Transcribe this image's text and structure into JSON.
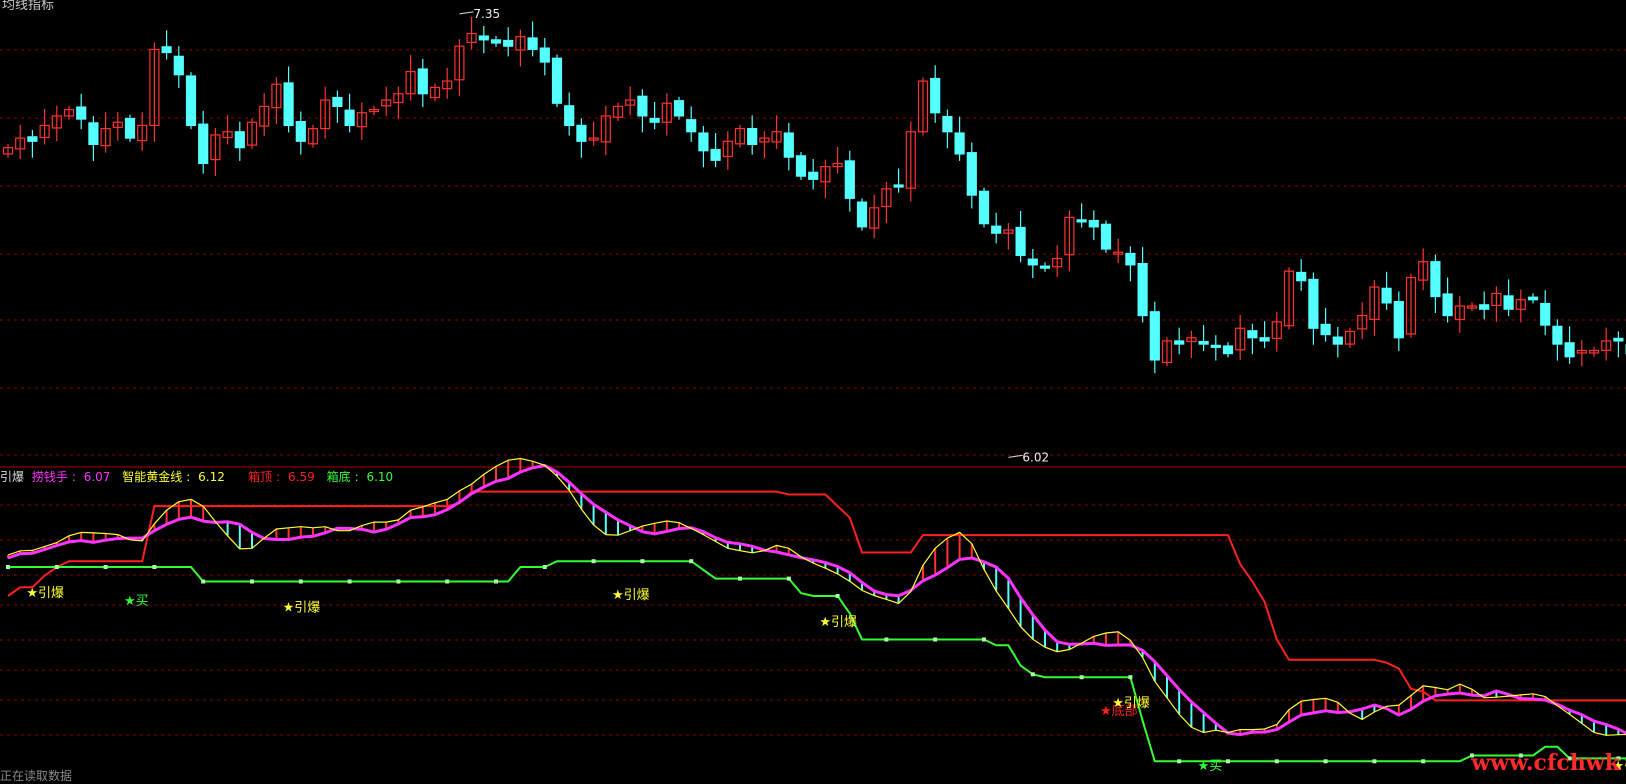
{
  "top_left_text": "均线指标",
  "main_annotations": {
    "high": "7.35",
    "low": "6.02"
  },
  "indicator_legend": {
    "name": "引爆",
    "items": [
      {
        "label": "捞钱手",
        "value": "6.07",
        "color": "#ff33ff"
      },
      {
        "label": "智能黄金线",
        "value": "6.12",
        "color": "#ffff33"
      },
      {
        "label": "箱顶",
        "value": "6.59",
        "color": "#ff2020"
      },
      {
        "label": "箱底",
        "value": "6.10",
        "color": "#33ff33"
      }
    ]
  },
  "watermark": "www.cfchwk",
  "bottom_left_text": "正在读取数据",
  "colors": {
    "up": "#ff3232",
    "down": "#54ffff",
    "grid": "#8b0000",
    "box_top": "#ff2020",
    "box_bottom": "#33ff33",
    "magenta": "#ff33ff",
    "yellow": "#ffff33"
  },
  "chart_data": [
    {
      "type": "candlestick",
      "ylim": [
        5.98,
        7.4
      ],
      "high_label": 7.35,
      "low_label": 6.02,
      "closes": [
        6.95,
        6.98,
        6.97,
        7.02,
        7.05,
        7.07,
        7.04,
        6.96,
        7.01,
        7.03,
        6.98,
        7.02,
        7.26,
        7.25,
        7.18,
        7.02,
        6.9,
        6.99,
        7.0,
        6.95,
        7.03,
        7.08,
        7.15,
        7.02,
        6.97,
        7.01,
        7.1,
        7.08,
        7.02,
        7.06,
        7.07,
        7.1,
        7.12,
        7.19,
        7.12,
        7.14,
        7.16,
        7.27,
        7.31,
        7.29,
        7.28,
        7.27,
        7.3,
        7.26,
        7.22,
        7.09,
        7.02,
        6.97,
        6.98,
        7.05,
        7.08,
        7.1,
        7.05,
        7.03,
        7.09,
        7.05,
        7.0,
        6.94,
        6.91,
        6.97,
        7.01,
        6.96,
        6.98,
        7.0,
        6.92,
        6.86,
        6.85,
        6.89,
        6.9,
        6.79,
        6.7,
        6.76,
        6.82,
        6.83,
        7.0,
        7.16,
        7.06,
        7.0,
        6.93,
        6.8,
        6.71,
        6.68,
        6.69,
        6.61,
        6.58,
        6.57,
        6.6,
        6.73,
        6.72,
        6.7,
        6.63,
        6.62,
        6.58,
        6.42,
        6.28,
        6.34,
        6.33,
        6.35,
        6.33,
        6.32,
        6.3,
        6.38,
        6.35,
        6.34,
        6.4,
        6.56,
        6.53,
        6.38,
        6.36,
        6.33,
        6.37,
        6.42,
        6.51,
        6.46,
        6.35,
        6.54,
        6.59,
        6.48,
        6.42,
        6.45,
        6.45,
        6.44,
        6.49,
        6.44,
        6.47,
        6.47,
        6.39,
        6.33,
        6.29,
        6.31,
        6.31,
        6.34,
        6.34,
        6.3,
        6.3,
        6.29,
        6.28
      ],
      "y_annotations": [
        {
          "x_index": 37,
          "value": 7.35
        },
        {
          "x_index": 82,
          "value": 6.02
        }
      ]
    },
    {
      "type": "line",
      "series": [
        {
          "name": "捞钱手",
          "color": "#ff33ff"
        },
        {
          "name": "智能黄金线",
          "color": "#ffff33"
        },
        {
          "name": "箱顶",
          "color": "#ff2020"
        },
        {
          "name": "箱底",
          "color": "#33ff33"
        }
      ],
      "last_values": {
        "捞钱手": 6.07,
        "智能黄金线": 6.12,
        "箱顶": 6.59,
        "箱底": 6.1
      },
      "signals": [
        {
          "text": "★引爆",
          "color": "#ffff33",
          "x_index": 2
        },
        {
          "text": "★买",
          "color": "#33ff33",
          "x_index": 10
        },
        {
          "text": "★引爆",
          "color": "#ffff33",
          "x_index": 23
        },
        {
          "text": "★引爆",
          "color": "#ffff33",
          "x_index": 50
        },
        {
          "text": "★引爆",
          "color": "#ffff33",
          "x_index": 67
        },
        {
          "text": "★底部",
          "color": "#ff2020",
          "x_index": 90
        },
        {
          "text": "★引爆",
          "color": "#ffff33",
          "x_index": 91
        },
        {
          "text": "★买",
          "color": "#33ff33",
          "x_index": 98
        },
        {
          "text": "★引爆",
          "color": "#ffff33",
          "x_index": 132
        }
      ]
    }
  ]
}
